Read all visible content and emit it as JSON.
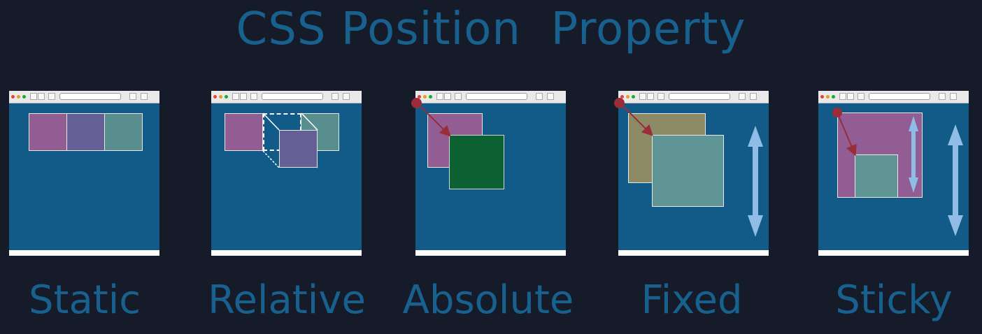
{
  "title": "CSS Position  Property",
  "panels": [
    {
      "id": "static",
      "label": "Static"
    },
    {
      "id": "relative",
      "label": "Relative"
    },
    {
      "id": "absolute",
      "label": "Absolute"
    },
    {
      "id": "fixed",
      "label": "Fixed"
    },
    {
      "id": "sticky",
      "label": "Sticky"
    }
  ],
  "colors": {
    "background": "#151b28",
    "title": "#18618f",
    "viewport": "#125a88",
    "pink": "#925d93",
    "purple": "#655f98",
    "teal": "#598e8f",
    "dark_green": "#0c6233",
    "olive": "#8d8a66",
    "arrow_light": "#8fbde6",
    "origin_marker": "#9a2d39"
  },
  "icons": [
    "browser-window",
    "close-dot",
    "minimize-dot",
    "maximize-dot",
    "address-bar",
    "origin-marker",
    "offset-arrow",
    "scroll-arrow"
  ]
}
